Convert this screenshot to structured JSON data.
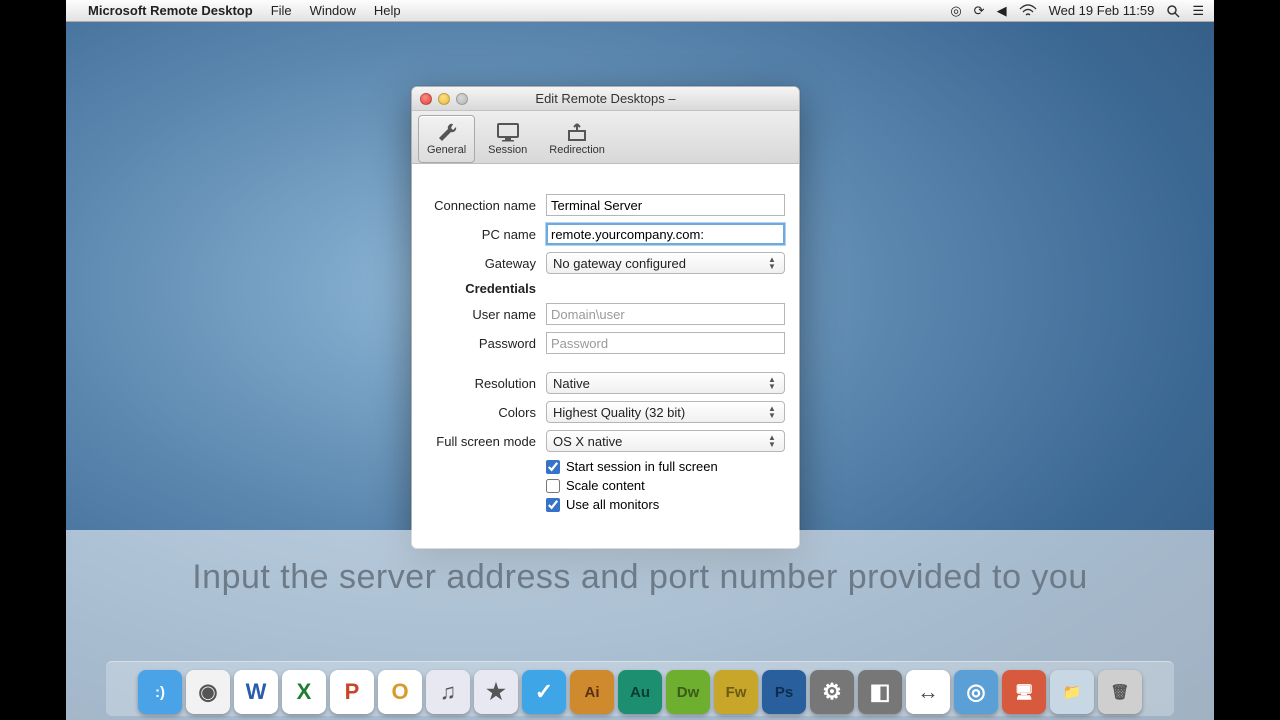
{
  "menubar": {
    "app_name": "Microsoft Remote Desktop",
    "items": [
      "File",
      "Window",
      "Help"
    ],
    "datetime": "Wed 19 Feb  11:59"
  },
  "window": {
    "title": "Edit Remote Desktops –",
    "toolbar": {
      "general": "General",
      "session": "Session",
      "redirection": "Redirection"
    },
    "labels": {
      "connection_name": "Connection name",
      "pc_name": "PC name",
      "gateway": "Gateway",
      "credentials": "Credentials",
      "user_name": "User name",
      "password": "Password",
      "resolution": "Resolution",
      "colors": "Colors",
      "fullscreen_mode": "Full screen mode"
    },
    "values": {
      "connection_name": "Terminal Server",
      "pc_name": "remote.yourcompany.com:",
      "gateway": "No gateway configured",
      "user_name_placeholder": "Domain\\user",
      "password_placeholder": "Password",
      "resolution": "Native",
      "colors": "Highest Quality (32 bit)",
      "fullscreen_mode": "OS X native"
    },
    "checkboxes": {
      "start_fullscreen": {
        "label": "Start session in full screen",
        "checked": true
      },
      "scale_content": {
        "label": "Scale content",
        "checked": false
      },
      "use_all_monitors": {
        "label": "Use all monitors",
        "checked": true
      }
    }
  },
  "caption": "Input the server address and port number provided to you",
  "dock": {
    "items": [
      {
        "name": "finder",
        "bg": "#4aa3e6",
        "glyph": ":)"
      },
      {
        "name": "chrome",
        "bg": "#f2f2f2",
        "glyph": "◉"
      },
      {
        "name": "word",
        "bg": "#ffffff",
        "glyph": "W"
      },
      {
        "name": "excel",
        "bg": "#ffffff",
        "glyph": "X"
      },
      {
        "name": "powerpoint",
        "bg": "#ffffff",
        "glyph": "P"
      },
      {
        "name": "outlook",
        "bg": "#ffffff",
        "glyph": "O"
      },
      {
        "name": "itunes",
        "bg": "#e8e8f2",
        "glyph": "♫"
      },
      {
        "name": "imovie",
        "bg": "#e8e8f2",
        "glyph": "★"
      },
      {
        "name": "mail",
        "bg": "#3ea5e6",
        "glyph": "✓"
      },
      {
        "name": "illustrator",
        "bg": "#d08a2e",
        "glyph": "Ai"
      },
      {
        "name": "audition",
        "bg": "#1b8f6f",
        "glyph": "Au"
      },
      {
        "name": "dreamweaver",
        "bg": "#6faf2f",
        "glyph": "Dw"
      },
      {
        "name": "fireworks",
        "bg": "#c8a62a",
        "glyph": "Fw"
      },
      {
        "name": "photoshop",
        "bg": "#2a5f9e",
        "glyph": "Ps"
      },
      {
        "name": "settings",
        "bg": "#777",
        "glyph": "⚙"
      },
      {
        "name": "cube",
        "bg": "#777",
        "glyph": "◧"
      },
      {
        "name": "teamviewer",
        "bg": "#ffffff",
        "glyph": "↔"
      },
      {
        "name": "safari",
        "bg": "#5aa0d6",
        "glyph": "◎"
      },
      {
        "name": "remote-desktop",
        "bg": "#d85a3e",
        "glyph": "🖥"
      },
      {
        "name": "folder",
        "bg": "#c8d7e4",
        "glyph": "📁"
      },
      {
        "name": "trash",
        "bg": "#cfcfcf",
        "glyph": "🗑"
      }
    ]
  }
}
